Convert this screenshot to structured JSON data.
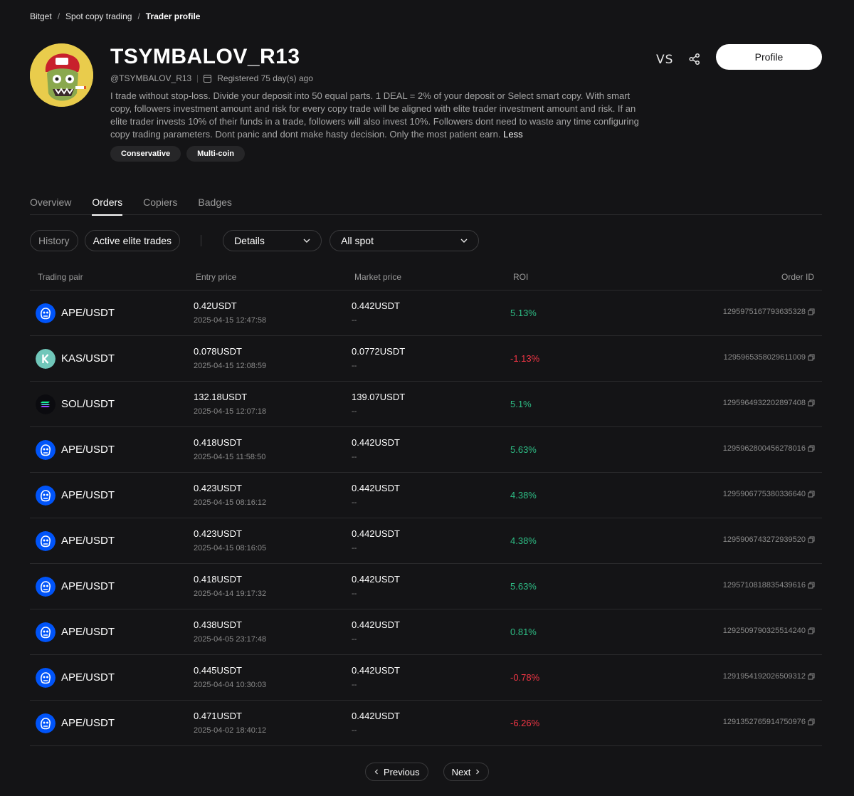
{
  "breadcrumb": [
    "Bitget",
    "Spot copy trading",
    "Trader profile"
  ],
  "trader": {
    "name": "TSYMBALOV_R13",
    "handle": "@TSYMBALOV_R13",
    "registered": "Registered 75 day(s) ago",
    "bio": "I trade without stop-loss. Divide your deposit into 50 equal parts. 1 DEAL = 2% of your deposit or Select smart copy. With smart copy, followers investment amount and risk for every copy trade will be aligned with elite trader investment amount and risk. If an elite trader invests 10% of their funds in a trade, followers will also invest 10%. Followers dont need to waste any time configuring copy trading parameters. Dont panic and dont make hasty decision. Only the most patient earn.",
    "less_label": "Less",
    "tags": [
      "Conservative",
      "Multi-coin"
    ]
  },
  "header_actions": {
    "vs_label": "VS",
    "profile_label": "Profile"
  },
  "tabs": [
    {
      "label": "Overview",
      "active": false
    },
    {
      "label": "Orders",
      "active": true
    },
    {
      "label": "Copiers",
      "active": false
    },
    {
      "label": "Badges",
      "active": false
    }
  ],
  "filters": {
    "history_label": "History",
    "active_label": "Active elite trades",
    "details_label": "Details",
    "spot_label": "All spot"
  },
  "columns": {
    "pair": "Trading pair",
    "entry": "Entry price",
    "market": "Market price",
    "roi": "ROI",
    "order_id": "Order ID"
  },
  "orders": [
    {
      "coin": "ape",
      "pair": "APE/USDT",
      "entry": "0.42USDT",
      "time": "2025-04-15 12:47:58",
      "market": "0.442USDT",
      "market_sub": "--",
      "roi": "5.13%",
      "roi_sign": "pos",
      "order_id": "1295975167793635328"
    },
    {
      "coin": "kas",
      "pair": "KAS/USDT",
      "entry": "0.078USDT",
      "time": "2025-04-15 12:08:59",
      "market": "0.0772USDT",
      "market_sub": "--",
      "roi": "-1.13%",
      "roi_sign": "neg",
      "order_id": "1295965358029611009"
    },
    {
      "coin": "sol",
      "pair": "SOL/USDT",
      "entry": "132.18USDT",
      "time": "2025-04-15 12:07:18",
      "market": "139.07USDT",
      "market_sub": "--",
      "roi": "5.1%",
      "roi_sign": "pos",
      "order_id": "1295964932202897408"
    },
    {
      "coin": "ape",
      "pair": "APE/USDT",
      "entry": "0.418USDT",
      "time": "2025-04-15 11:58:50",
      "market": "0.442USDT",
      "market_sub": "--",
      "roi": "5.63%",
      "roi_sign": "pos",
      "order_id": "1295962800456278016"
    },
    {
      "coin": "ape",
      "pair": "APE/USDT",
      "entry": "0.423USDT",
      "time": "2025-04-15 08:16:12",
      "market": "0.442USDT",
      "market_sub": "--",
      "roi": "4.38%",
      "roi_sign": "pos",
      "order_id": "1295906775380336640"
    },
    {
      "coin": "ape",
      "pair": "APE/USDT",
      "entry": "0.423USDT",
      "time": "2025-04-15 08:16:05",
      "market": "0.442USDT",
      "market_sub": "--",
      "roi": "4.38%",
      "roi_sign": "pos",
      "order_id": "1295906743272939520"
    },
    {
      "coin": "ape",
      "pair": "APE/USDT",
      "entry": "0.418USDT",
      "time": "2025-04-14 19:17:32",
      "market": "0.442USDT",
      "market_sub": "--",
      "roi": "5.63%",
      "roi_sign": "pos",
      "order_id": "1295710818835439616"
    },
    {
      "coin": "ape",
      "pair": "APE/USDT",
      "entry": "0.438USDT",
      "time": "2025-04-05 23:17:48",
      "market": "0.442USDT",
      "market_sub": "--",
      "roi": "0.81%",
      "roi_sign": "pos",
      "order_id": "1292509790325514240"
    },
    {
      "coin": "ape",
      "pair": "APE/USDT",
      "entry": "0.445USDT",
      "time": "2025-04-04 10:30:03",
      "market": "0.442USDT",
      "market_sub": "--",
      "roi": "-0.78%",
      "roi_sign": "neg",
      "order_id": "1291954192026509312"
    },
    {
      "coin": "ape",
      "pair": "APE/USDT",
      "entry": "0.471USDT",
      "time": "2025-04-02 18:40:12",
      "market": "0.442USDT",
      "market_sub": "--",
      "roi": "-6.26%",
      "roi_sign": "neg",
      "order_id": "1291352765914750976"
    }
  ],
  "pagination": {
    "prev_label": "Previous",
    "next_label": "Next"
  },
  "colors": {
    "background": "#141416",
    "positive": "#2ebd85",
    "negative": "#f23645",
    "ape": "#0054f9",
    "kas": "#70c7ba"
  }
}
